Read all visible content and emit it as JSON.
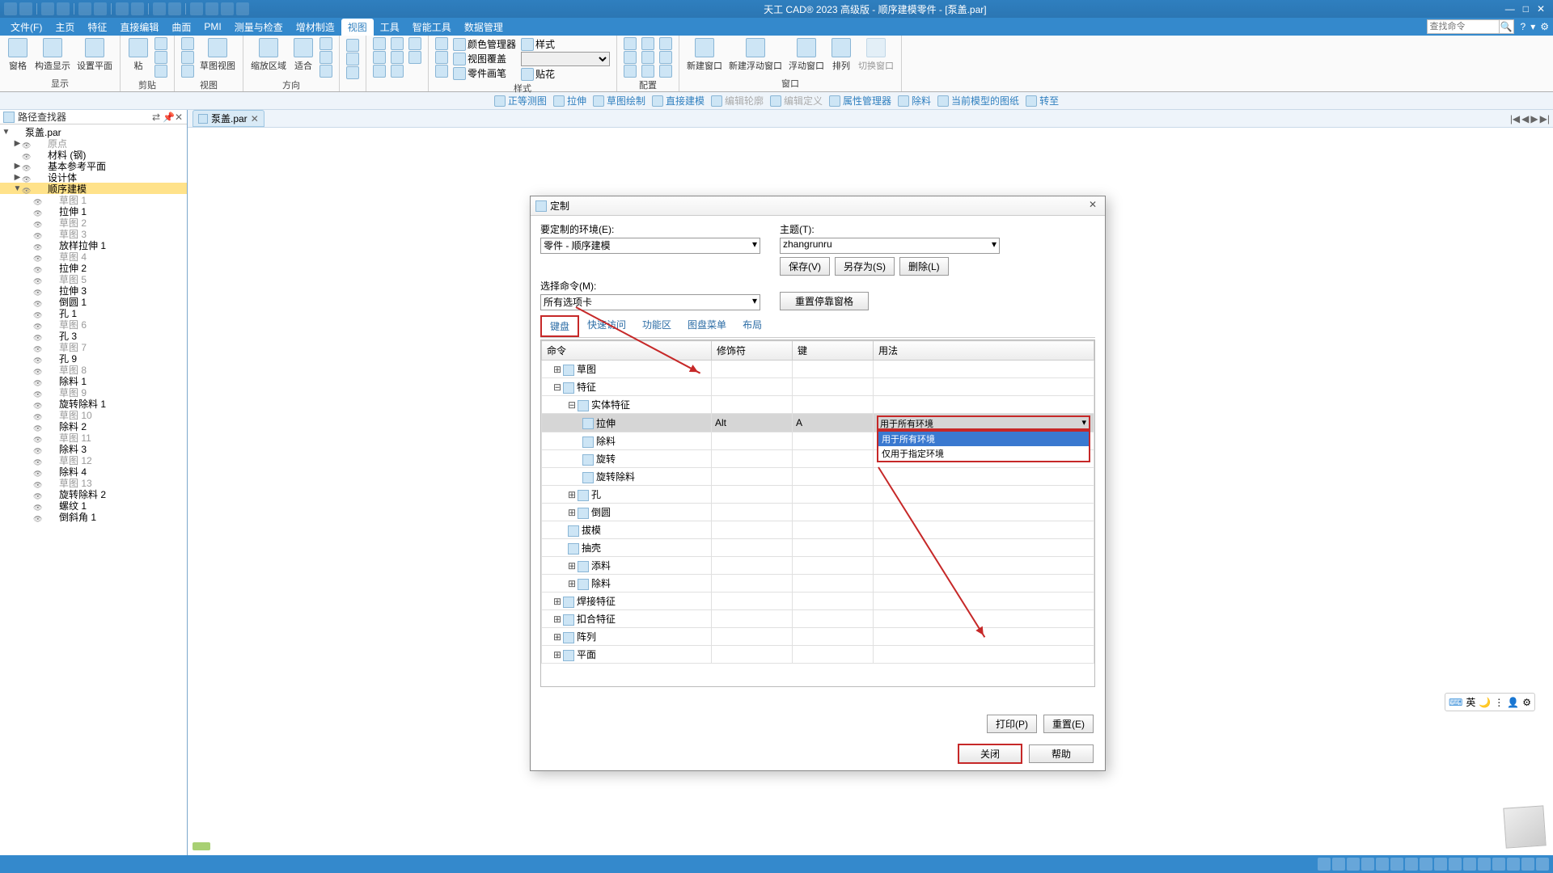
{
  "app": {
    "title": "天工 CAD® 2023 高级版 - 顺序建模零件 - [泵盖.par]"
  },
  "menu": [
    "文件(F)",
    "主页",
    "特征",
    "直接编辑",
    "曲面",
    "PMI",
    "测量与检查",
    "增材制造",
    "视图",
    "工具",
    "智能工具",
    "数据管理"
  ],
  "menu_active": 8,
  "search_placeholder": "查找命令",
  "ribbon": {
    "groups": [
      {
        "label": "显示",
        "btns": [
          {
            "t": "窗格"
          },
          {
            "t": "构造显示"
          },
          {
            "t": "设置平面"
          }
        ]
      },
      {
        "label": "剪贴",
        "btns": [
          {
            "t": "粘"
          }
        ]
      },
      {
        "label": "视图",
        "btns": [
          {
            "t": "草图视图"
          }
        ]
      },
      {
        "label": "方向",
        "btns": [
          {
            "t": "缩放区域"
          },
          {
            "t": "适合"
          }
        ]
      },
      {
        "label": "样式",
        "btns": [
          {
            "t": "颜色管理器"
          },
          {
            "t": "视图覆盖"
          },
          {
            "t": "零件画笔"
          },
          {
            "t": "贴花"
          }
        ]
      },
      {
        "label": "配置",
        "btns": []
      },
      {
        "label": "窗口",
        "btns": [
          {
            "t": "新建窗口"
          },
          {
            "t": "新建浮动窗口"
          },
          {
            "t": "浮动窗口"
          },
          {
            "t": "排列"
          },
          {
            "t": "切换窗口"
          }
        ]
      }
    ]
  },
  "toolbar2": [
    {
      "t": "正等测图",
      "en": true
    },
    {
      "t": "拉伸",
      "en": true
    },
    {
      "t": "草图绘制",
      "en": true
    },
    {
      "t": "直接建模",
      "en": true
    },
    {
      "t": "编辑轮廓",
      "en": false
    },
    {
      "t": "编辑定义",
      "en": false
    },
    {
      "t": "属性管理器",
      "en": true
    },
    {
      "t": "除料",
      "en": true
    },
    {
      "t": "当前模型的图纸",
      "en": true
    },
    {
      "t": "转至",
      "en": true
    }
  ],
  "sidebar": {
    "title": "路径查找器",
    "root": "泵盖.par",
    "items": [
      {
        "lvl": 1,
        "t": "原点",
        "exp": "▶",
        "dim": true
      },
      {
        "lvl": 1,
        "t": "材料 (钢)"
      },
      {
        "lvl": 1,
        "t": "基本参考平面",
        "exp": "▶"
      },
      {
        "lvl": 1,
        "t": "设计体",
        "exp": "▶"
      },
      {
        "lvl": 1,
        "t": "顺序建模",
        "sel": true,
        "exp": "▼"
      },
      {
        "lvl": 2,
        "t": "草图 1",
        "dim": true
      },
      {
        "lvl": 2,
        "t": "拉伸 1"
      },
      {
        "lvl": 2,
        "t": "草图 2",
        "dim": true
      },
      {
        "lvl": 2,
        "t": "草图 3",
        "dim": true
      },
      {
        "lvl": 2,
        "t": "放样拉伸 1"
      },
      {
        "lvl": 2,
        "t": "草图 4",
        "dim": true
      },
      {
        "lvl": 2,
        "t": "拉伸 2"
      },
      {
        "lvl": 2,
        "t": "草图 5",
        "dim": true
      },
      {
        "lvl": 2,
        "t": "拉伸 3"
      },
      {
        "lvl": 2,
        "t": "倒圆 1"
      },
      {
        "lvl": 2,
        "t": "孔 1"
      },
      {
        "lvl": 2,
        "t": "草图 6",
        "dim": true
      },
      {
        "lvl": 2,
        "t": "孔 3"
      },
      {
        "lvl": 2,
        "t": "草图 7",
        "dim": true
      },
      {
        "lvl": 2,
        "t": "孔 9"
      },
      {
        "lvl": 2,
        "t": "草图 8",
        "dim": true
      },
      {
        "lvl": 2,
        "t": "除料 1"
      },
      {
        "lvl": 2,
        "t": "草图 9",
        "dim": true
      },
      {
        "lvl": 2,
        "t": "旋转除料 1"
      },
      {
        "lvl": 2,
        "t": "草图 10",
        "dim": true
      },
      {
        "lvl": 2,
        "t": "除料 2"
      },
      {
        "lvl": 2,
        "t": "草图 11",
        "dim": true
      },
      {
        "lvl": 2,
        "t": "除料 3"
      },
      {
        "lvl": 2,
        "t": "草图 12",
        "dim": true
      },
      {
        "lvl": 2,
        "t": "除料 4"
      },
      {
        "lvl": 2,
        "t": "草图 13",
        "dim": true
      },
      {
        "lvl": 2,
        "t": "旋转除料 2"
      },
      {
        "lvl": 2,
        "t": "螺纹 1"
      },
      {
        "lvl": 2,
        "t": "倒斜角 1"
      }
    ]
  },
  "doc_tab": "泵盖.par",
  "dialog": {
    "title": "定制",
    "env_label": "要定制的环境(E):",
    "env_value": "零件 - 顺序建模",
    "theme_label": "主题(T):",
    "theme_value": "zhangrunru",
    "cmd_label": "选择命令(M):",
    "cmd_value": "所有选项卡",
    "save_btn": "保存(V)",
    "saveas_btn": "另存为(S)",
    "delete_btn": "删除(L)",
    "reset_btn": "重置停靠窗格",
    "tabs": [
      "键盘",
      "快速访问",
      "功能区",
      "图盘菜单",
      "布局"
    ],
    "tab_active": 0,
    "grid": {
      "cols": [
        "命令",
        "修饰符",
        "键",
        "用法"
      ],
      "rows": [
        {
          "lvl": 0,
          "t": "草图",
          "exp": "+"
        },
        {
          "lvl": 0,
          "t": "特征",
          "exp": "-"
        },
        {
          "lvl": 1,
          "t": "实体特征",
          "exp": "-"
        },
        {
          "lvl": 2,
          "t": "拉伸",
          "sel": true,
          "mod": "Alt",
          "key": "A",
          "usage_sel": true
        },
        {
          "lvl": 2,
          "t": "除料"
        },
        {
          "lvl": 2,
          "t": "旋转"
        },
        {
          "lvl": 2,
          "t": "旋转除料"
        },
        {
          "lvl": 1,
          "t": "孔",
          "exp": "+"
        },
        {
          "lvl": 1,
          "t": "倒圆",
          "exp": "+"
        },
        {
          "lvl": 1,
          "t": "拔模"
        },
        {
          "lvl": 1,
          "t": "抽壳"
        },
        {
          "lvl": 1,
          "t": "添料",
          "exp": "+"
        },
        {
          "lvl": 1,
          "t": "除料",
          "exp": "+"
        },
        {
          "lvl": 0,
          "t": "焊接特征",
          "exp": "+"
        },
        {
          "lvl": 0,
          "t": "扣合特征",
          "exp": "+"
        },
        {
          "lvl": 0,
          "t": "阵列",
          "exp": "+"
        },
        {
          "lvl": 0,
          "t": "平面",
          "exp": "+"
        }
      ],
      "usage_options": [
        "用于所有环境",
        "仅用于指定环境"
      ],
      "usage_current": "用于所有环境"
    },
    "print_btn": "打印(P)",
    "reset2_btn": "重置(E)",
    "close_btn": "关闭",
    "help_btn": "帮助"
  },
  "ime": {
    "lang": "英"
  }
}
